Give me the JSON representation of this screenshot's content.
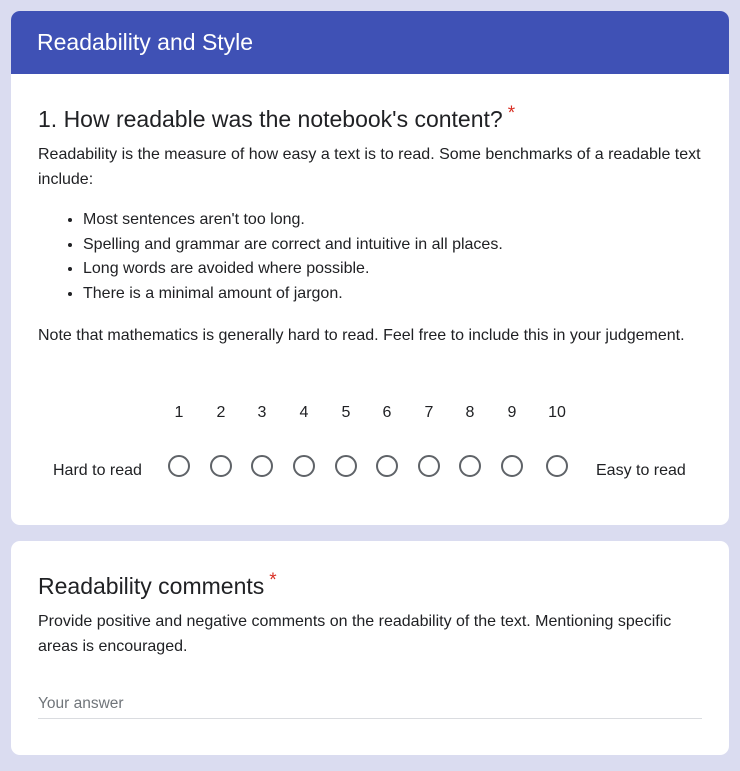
{
  "section": {
    "title": "Readability and Style"
  },
  "question1": {
    "title": "1. How readable was the notebook's content?",
    "required_mark": "*",
    "intro": "Readability is the measure of how easy a text is to read. Some benchmarks of a readable text include:",
    "bullets": [
      "Most sentences aren't too long.",
      "Spelling and grammar are correct and intuitive in all places.",
      "Long words are avoided where possible.",
      "There is a minimal amount of jargon."
    ],
    "note": "Note that mathematics is generally hard to read. Feel free to include this in your judgement.",
    "scale": {
      "numbers": [
        "1",
        "2",
        "3",
        "4",
        "5",
        "6",
        "7",
        "8",
        "9",
        "10"
      ],
      "low_label": "Hard to read",
      "high_label": "Easy to read"
    }
  },
  "question2": {
    "title": "Readability comments",
    "required_mark": "*",
    "description": "Provide positive and negative comments on the readability of the text. Mentioning specific areas is encouraged.",
    "answer_placeholder": "Your answer",
    "answer_value": ""
  },
  "colors": {
    "page_background": "#dadcf0",
    "header_background": "#3f51b5",
    "required_mark": "#d93025",
    "radio_border": "#5f6368"
  }
}
